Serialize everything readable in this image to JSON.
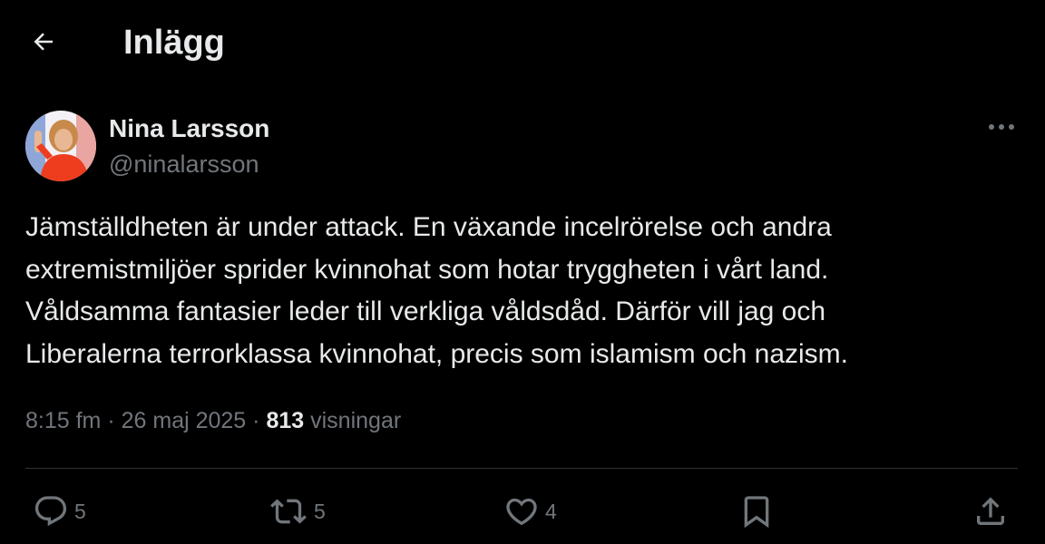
{
  "header": {
    "title": "Inlägg",
    "back_icon": "arrow-left-icon"
  },
  "author": {
    "name": "Nina Larsson",
    "handle": "@ninalarsson",
    "avatar_icon": "avatar-photo"
  },
  "tweet": {
    "lines": [
      "Jämställdheten är under attack. En växande incelrörelse och andra",
      "extremistmiljöer sprider kvinnohat som hotar tryggheten i vårt land.",
      "Våldsamma fantasier leder till verkliga våldsdåd. Därför vill jag och",
      "Liberalerna terrorklassa kvinnohat, precis som islamism och nazism."
    ],
    "time": "8:15 fm",
    "sep1": "·",
    "date": "26 maj 2025",
    "sep2": "·",
    "views": "813",
    "views_label": "visningar"
  },
  "actions": {
    "reply_count": "5",
    "retweet_count": "5",
    "like_count": "4"
  },
  "colors": {
    "background": "#000000",
    "text": "#e7e9ea",
    "secondary": "#71767b",
    "divider": "#2f3336"
  }
}
